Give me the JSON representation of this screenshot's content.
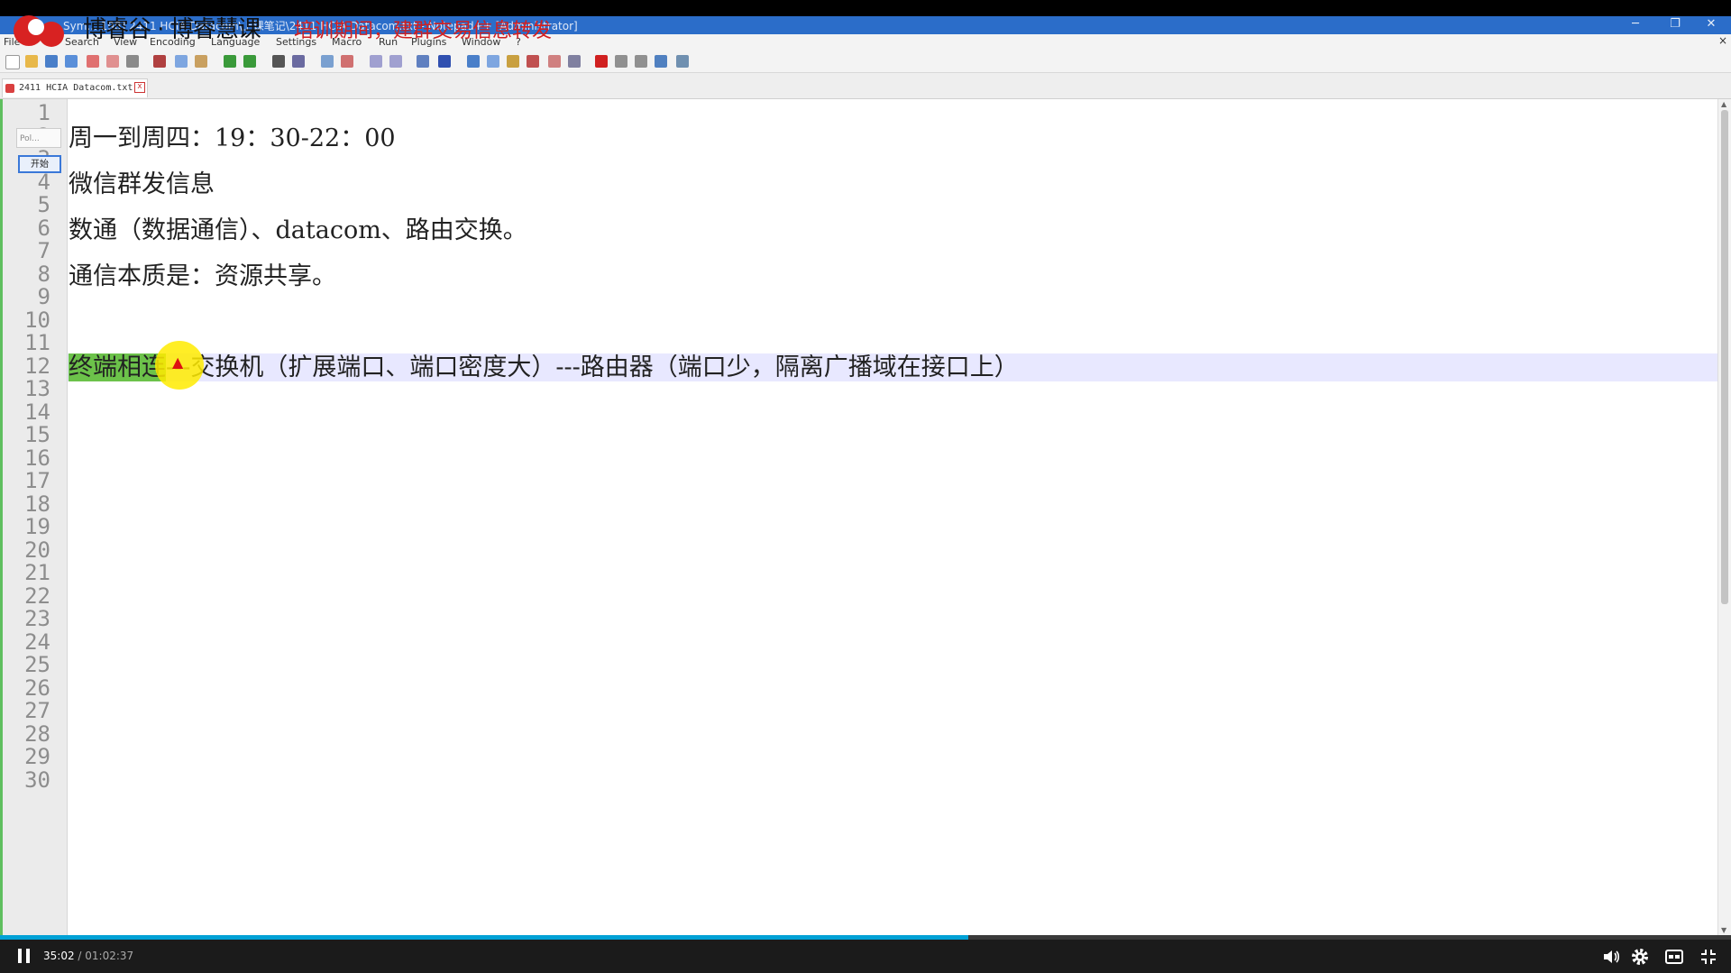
{
  "overlay": {
    "brand": "博睿谷 · 博睿慧课",
    "subtitle_red": "培训期间，建群交易信息转发"
  },
  "window": {
    "title": "Sym... 198] 2411 HCIA Datacom\\上课笔记\\2411 HCIA Datacom.txt - Notepad++ [Administrator]",
    "minimize": "─",
    "maximize": "❐",
    "close": "✕"
  },
  "menu": {
    "items": [
      "File",
      "Search",
      "View",
      "Encoding",
      "Language",
      "Settings",
      "Macro",
      "Run",
      "Plugins",
      "Window",
      "?"
    ],
    "close_x": "×"
  },
  "tab": {
    "label": "2411 HCIA Datacom.txt",
    "close": "x"
  },
  "mini_panel": {
    "top": "Pol...",
    "button": "开始"
  },
  "editor": {
    "line_numbers": [
      "1",
      "2",
      "3",
      "4",
      "5",
      "6",
      "7",
      "8",
      "9",
      "10",
      "11",
      "12",
      "13",
      "14",
      "15",
      "16",
      "17",
      "18",
      "19",
      "20",
      "21",
      "22",
      "23",
      "24",
      "25",
      "26",
      "27",
      "28",
      "29",
      "30"
    ],
    "lines": {
      "l2": "周一到周四：19：30-22：00",
      "l4": "微信群发信息",
      "l6": "数通（数据通信）、datacom、路由交换。",
      "l8": "通信本质是：资源共享。",
      "l10_selected": "终端相连",
      "l10_rest": "---交换机（扩展端口、端口密度大）---路由器（端口少，隔离广播域在接口上）"
    },
    "current_line": 10
  },
  "player": {
    "current_time": "35:02",
    "separator": " / ",
    "total_time": "01:02:37",
    "progress_fraction": 0.5595,
    "accent": "#00a1d6"
  },
  "colors": {
    "titlebar": "#2b6dc9",
    "selection": "#6cc24a",
    "current_line": "#e8e8ff",
    "cursor_highlight": "#ffeb00"
  }
}
